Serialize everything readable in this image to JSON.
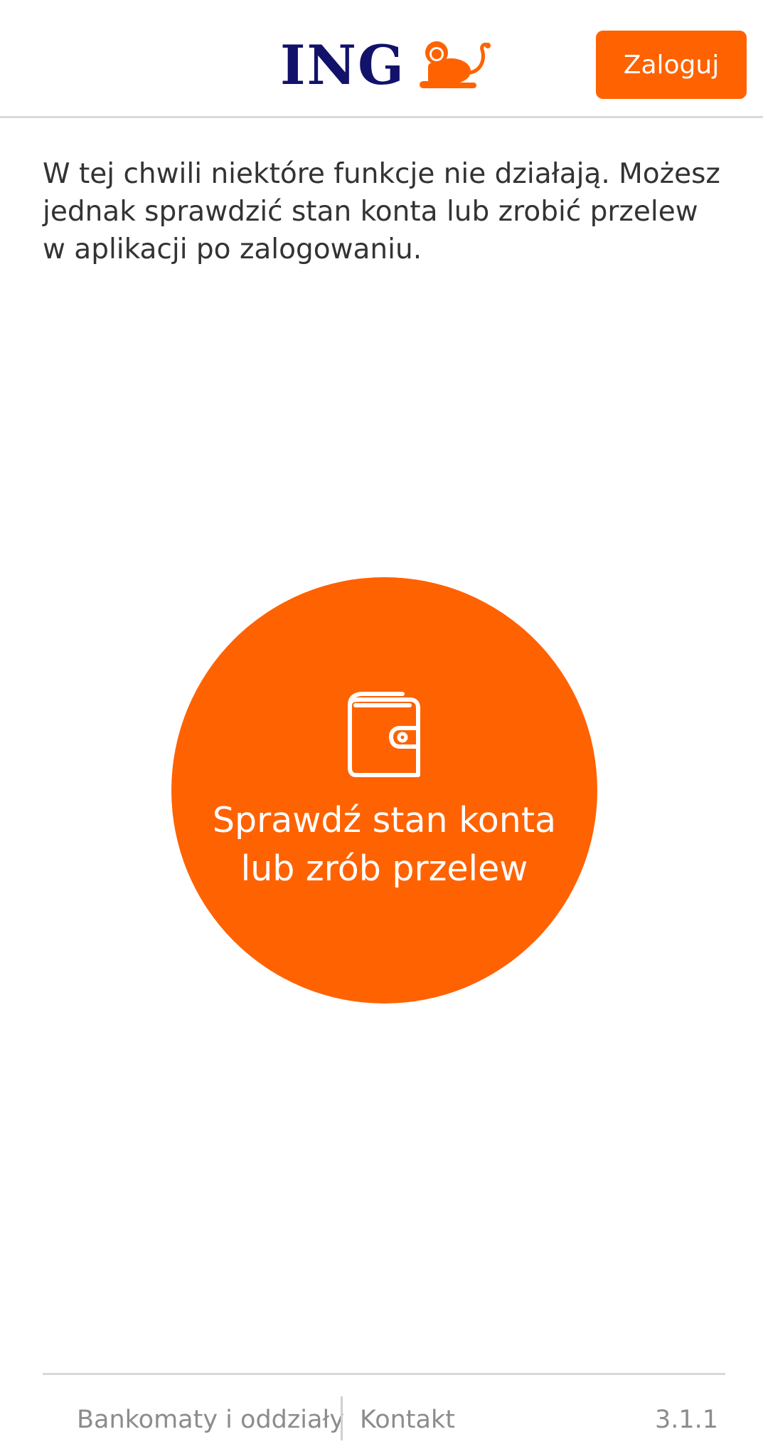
{
  "header": {
    "logo_text": "ING",
    "login_label": "Zaloguj"
  },
  "main": {
    "info_text": "W tej chwili niektóre funkcje nie działają. Możesz jednak sprawdzić stan konta lub zrobić przelew w aplikacji po zalogowaniu.",
    "action_label": "Sprawdź stan konta lub zrób przelew",
    "action_icon": "wallet-icon"
  },
  "footer": {
    "atm_label": "Bankomaty i oddziały",
    "contact_label": "Kontakt",
    "version": "3.1.1"
  },
  "colors": {
    "brand_orange": "#ff6200",
    "brand_navy": "#12126b"
  }
}
